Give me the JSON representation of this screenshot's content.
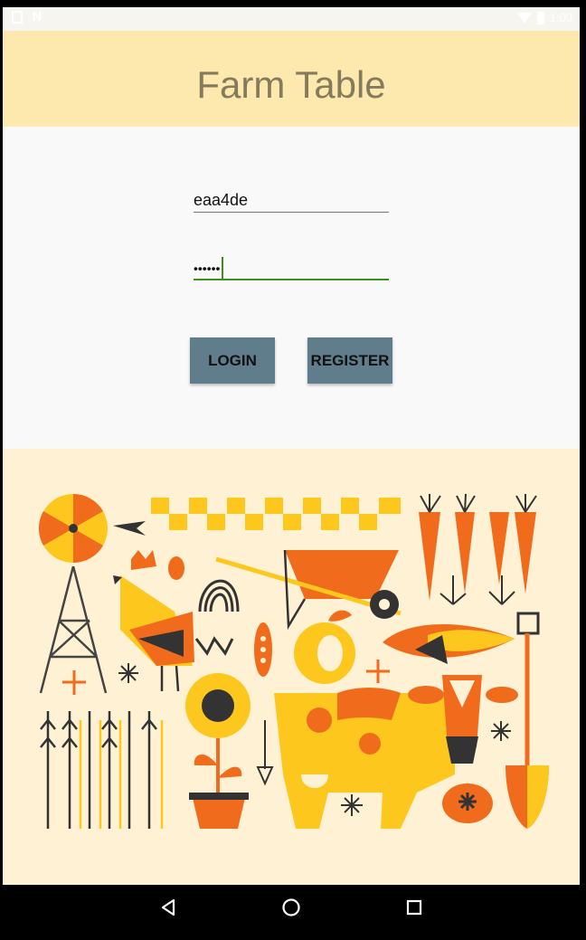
{
  "app": {
    "title": "Farm Table"
  },
  "status_bar": {
    "time": "1:00"
  },
  "login_form": {
    "username_value": "eaa4de",
    "password_value": "••••••"
  },
  "buttons": {
    "login_label": "LOGIN",
    "register_label": "REGISTER"
  },
  "colors": {
    "app_bar": "#fde9ad",
    "title_text": "#857a5c",
    "button": "#607d8b",
    "focus_underline": "#3e8e1e",
    "illustration_bg": "#fff2d4",
    "accent_orange": "#f06b1c",
    "accent_yellow": "#fdc71e"
  },
  "icons": {
    "back": "back-triangle-icon",
    "home": "home-circle-icon",
    "recent": "recent-apps-square-icon"
  }
}
